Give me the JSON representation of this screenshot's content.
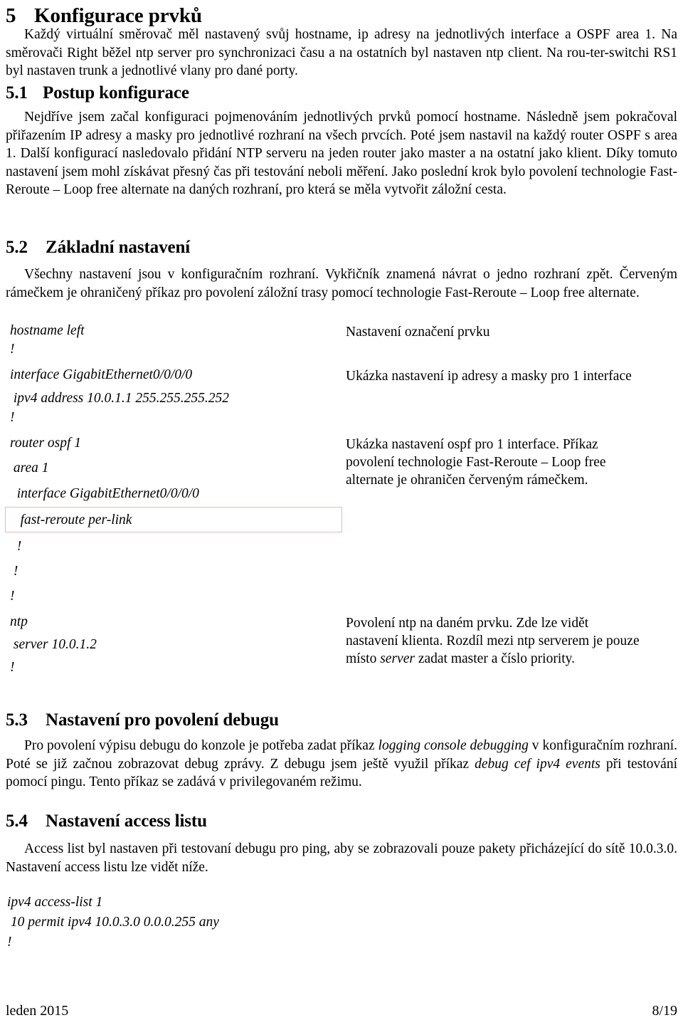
{
  "document": {
    "section_main": {
      "number": "5",
      "title": "Konfigurace prvků"
    },
    "intro_paragraph": "Každý virtuální směrovač měl nastavený svůj hostname, ip adresy na jednotlivých interface a OSPF area 1. Na směrovači Right běžel ntp server pro synchronizaci času a na ostatních byl nastaven ntp client. Na rou-ter-switchi RS1 byl nastaven trunk a jednotlivé vlany pro dané porty."
  },
  "section_5_1": {
    "number": "5.1",
    "title": "Postup konfigurace",
    "paragraph": "Nejdříve jsem začal konfiguraci pojmenováním jednotlivých prvků pomocí hostname. Následně jsem pokračoval přiřazením IP adresy a masky pro jednotlivé rozhraní na všech prvcích. Poté jsem nastavil na každý router OSPF s area 1. Další konfigurací nasledovalo přidání NTP serveru na jeden router jako master a na ostatní jako klient. Díky tomuto nastavení jsem mohl získávat přesný čas při testování neboli měření. Jako poslední krok bylo povolení technologie Fast-Reroute – Loop free alternate na daných rozhraní, pro která se měla vytvořit záložní cesta."
  },
  "section_5_2": {
    "number": "5.2",
    "title": "Základní nastavení",
    "paragraph": "Všechny nastavení jsou v konfiguračním rozhraní. Vykřičník znamená návrat o jedno rozhraní zpět. Červeným rámečkem je ohraničený příkaz pro povolení záložní trasy pomocí technologie Fast-Reroute – Loop free alternate.",
    "config_lines": [
      "hostname left",
      "!",
      "interface GigabitEthernet0/0/0/0",
      " ipv4 address 10.0.1.1 255.255.255.252",
      "!",
      "router ospf 1",
      " area 1",
      "  interface GigabitEthernet0/0/0/0",
      "   fast-reroute per-link",
      "  !",
      " !",
      "!",
      "ntp",
      " server 10.0.1.2",
      "!"
    ],
    "highlighted_line": "   fast-reroute per-link",
    "highlight_color": "#e8b9b9",
    "descriptions": {
      "hostname_desc": "Nastavení označení prvku",
      "interface_desc": "Ukázka nastavení ip adresy a masky pro 1 interface",
      "ospf_desc_line1": "Ukázka nastavení ospf pro 1 interface. Příkaz",
      "ospf_desc_line2": "povolení technologie  Fast-Reroute – Loop free",
      "ospf_desc_line3": "alternate je ohraničen červeným rámečkem.",
      "ntp_desc_line1": "Povolení ntp na daném prvku. Zde lze vidět",
      "ntp_desc_line2a": "nastavení klienta. Rozdíl mezi ntp serverem je pouze",
      "ntp_desc_line3a": "místo ",
      "ntp_desc_line3_italic": "server",
      "ntp_desc_line3b": " zadat master a číslo priority."
    }
  },
  "section_5_3": {
    "number": "5.3",
    "title": "Nastavení pro povolení debugu",
    "paragraph_a": "Pro povolení výpisu debugu do konzole je potřeba zadat příkaz ",
    "cmd_1": "logging console debugging",
    "paragraph_b": " v konfiguračním rozhraní. Poté se již začnou zobrazovat debug zprávy. Z debugu jsem ještě využil příkaz ",
    "cmd_2": "debug cef ipv4 events",
    "paragraph_c": " při testování pomocí pingu. Tento příkaz se zadává v privilegovaném režimu."
  },
  "section_5_4": {
    "number": "5.4",
    "title": "Nastavení access listu",
    "paragraph": "Access list byl nastaven při testovaní debugu pro ping, aby se zobrazovali pouze pakety přicházející do sítě 10.0.3.0. Nastavení access listu lze vidět níže.",
    "config_lines": [
      "ipv4 access-list 1",
      " 10 permit ipv4 10.0.3.0 0.0.0.255 any",
      "!"
    ]
  },
  "footer": {
    "left": "leden 2015",
    "right": "8/19"
  }
}
